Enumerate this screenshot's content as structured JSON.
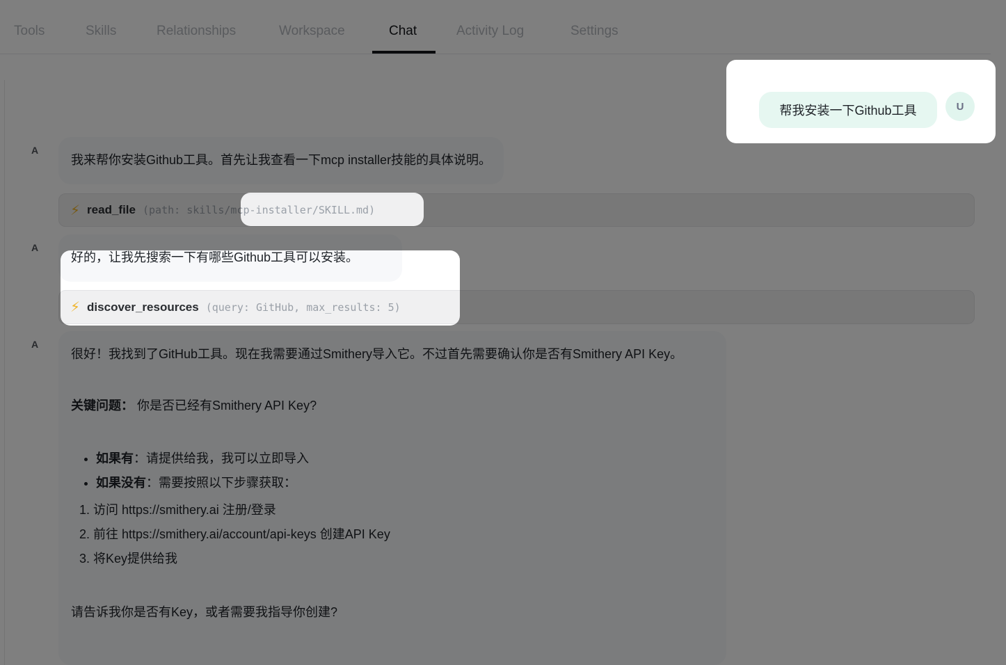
{
  "tabs": [
    "Tools",
    "Skills",
    "Relationships",
    "Workspace",
    "Chat",
    "Activity Log",
    "Settings"
  ],
  "active_tab": "Chat",
  "user_message": {
    "avatar": "U",
    "text": "帮我安装一下Github工具"
  },
  "messages": [
    {
      "avatar": "A",
      "text": "我来帮你安装Github工具。首先让我查看一下mcp installer技能的具体说明。",
      "tool": {
        "name": "read_file",
        "args": "(path: skills/mcp-installer/SKILL.md)"
      }
    },
    {
      "avatar": "A",
      "text": "好的，让我先搜索一下有哪些Github工具可以安装。",
      "tool": {
        "name": "discover_resources",
        "args": "(query: GitHub, max_results: 5)"
      }
    },
    {
      "avatar": "A",
      "intro": "很好！我找到了GitHub工具。现在我需要通过Smithery导入它。不过首先需要确认你是否有Smithery API Key。",
      "key_label": "关键问题：",
      "key_q": "你是否已经有Smithery API Key?",
      "bullets": [
        {
          "b": "如果有",
          "t": "：请提供给我，我可以立即导入"
        },
        {
          "b": "如果没有",
          "t": "：需要按照以下步骤获取："
        }
      ],
      "steps": [
        "访问 https://smithery.ai 注册/登录",
        "前往 https://smithery.ai/account/api-keys 创建API Key",
        "将Key提供给我"
      ],
      "outro": "请告诉我你是否有Key，或者需要我指导你创建?"
    }
  ],
  "colors": {
    "tool_icon": "#f0b429",
    "user_bubble": "#e6f7f1",
    "overlay": "rgba(0,0,0,0.5)"
  }
}
